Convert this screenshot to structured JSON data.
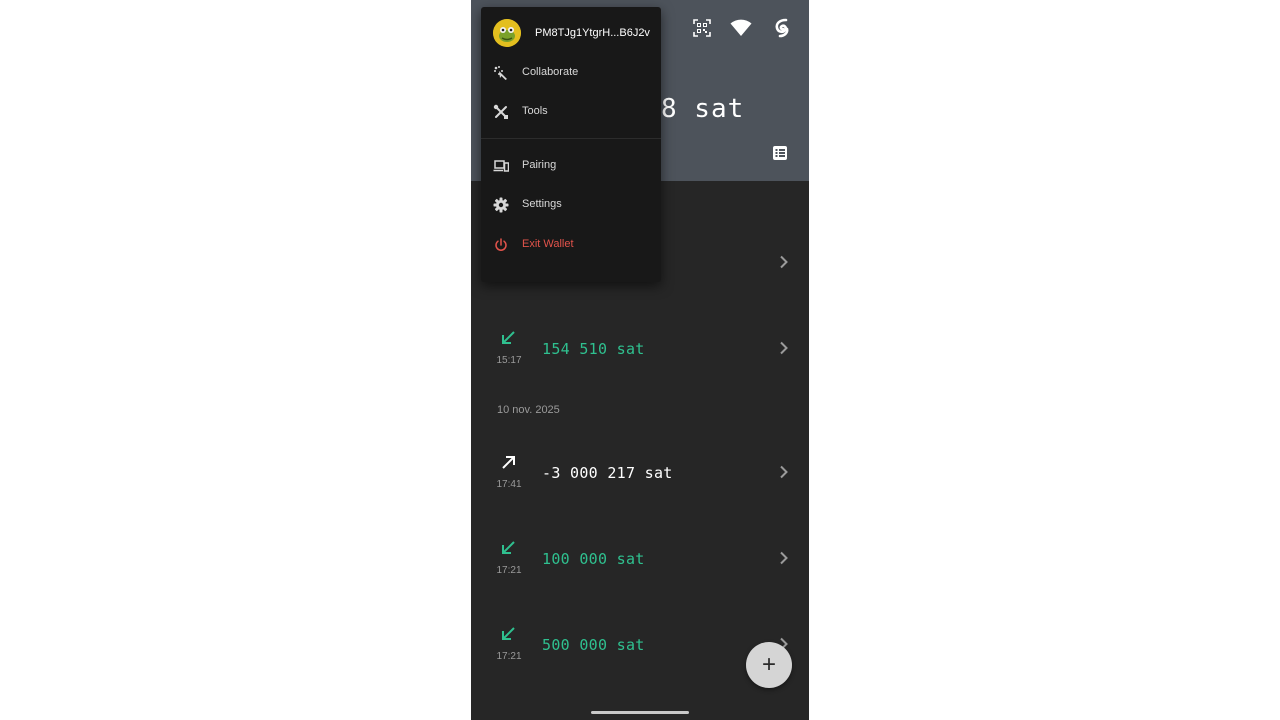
{
  "header": {
    "balance_visible": "8 sat",
    "icons": [
      "qr-scan-icon",
      "wifi-icon",
      "tor-icon",
      "list-icon"
    ]
  },
  "menu": {
    "account": "PM8TJg1YtgrH...B6J2v",
    "items": [
      {
        "label": "Collaborate",
        "icon": "collaborate-icon"
      },
      {
        "label": "Tools",
        "icon": "tools-icon"
      },
      {
        "label": "Pairing",
        "icon": "pairing-icon"
      },
      {
        "label": "Settings",
        "icon": "gear-icon"
      },
      {
        "label": "Exit Wallet",
        "icon": "power-icon"
      }
    ]
  },
  "transactions": {
    "items": [
      {
        "direction": "in",
        "time": "15:17",
        "amount": "154 510 sat"
      },
      {
        "direction": "out",
        "time": "17:41",
        "amount": "-3 000 217 sat"
      },
      {
        "direction": "in",
        "time": "17:21",
        "amount": "100 000 sat"
      },
      {
        "direction": "in",
        "time": "17:21",
        "amount": "500 000 sat"
      }
    ],
    "date_header": "10 nov. 2025"
  },
  "fab": {
    "label": "+"
  },
  "colors": {
    "header": "#4d535b",
    "background": "#262626",
    "incoming": "#2fc08f",
    "outgoing": "#ffffff",
    "danger": "#e2534b",
    "menu": "#181818"
  }
}
